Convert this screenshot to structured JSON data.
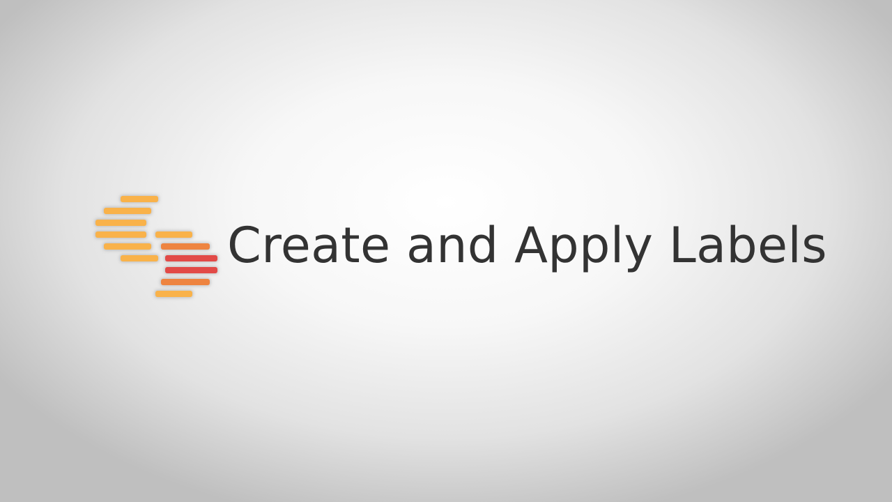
{
  "title": {
    "text": "Create and Apply Labels",
    "color": "#333333"
  },
  "logo": {
    "icon": "stacked-label-bars-logo",
    "colors": {
      "yellow": "#F9B24A",
      "orange": "#EE8440",
      "red": "#E24A47"
    }
  }
}
